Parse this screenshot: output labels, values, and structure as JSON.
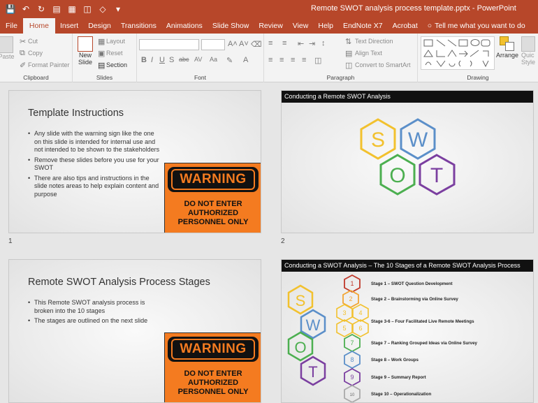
{
  "window": {
    "title": "Remote SWOT analysis process template.pptx  -  PowerPoint"
  },
  "tabs": [
    "File",
    "Home",
    "Insert",
    "Design",
    "Transitions",
    "Animations",
    "Slide Show",
    "Review",
    "View",
    "Help",
    "EndNote X7",
    "Acrobat"
  ],
  "active_tab": "Home",
  "tell_me": "Tell me what you want to do",
  "ribbon": {
    "clipboard": {
      "paste": "Paste",
      "cut": "Cut",
      "copy": "Copy",
      "format_painter": "Format Painter",
      "label": "Clipboard"
    },
    "slides": {
      "new_slide_1": "New",
      "new_slide_2": "Slide",
      "layout": "Layout",
      "reset": "Reset",
      "section": "Section",
      "label": "Slides"
    },
    "font": {
      "label": "Font"
    },
    "paragraph": {
      "text_direction": "Text Direction",
      "align_text": "Align Text",
      "convert_smartart": "Convert to SmartArt",
      "label": "Paragraph"
    },
    "drawing": {
      "arrange": "Arrange",
      "quick_styles_1": "Quic",
      "quick_styles_2": "Style",
      "label": "Drawing"
    }
  },
  "slides": [
    {
      "number": "1",
      "title": "Template Instructions",
      "bullets": [
        "Any slide with the warning sign like the one on this slide is intended for internal use and not intended to be shown to the stakeholders",
        "Remove these slides before you use for your SWOT",
        "There are also tips and instructions in the slide notes areas to help explain content and purpose"
      ],
      "warning": {
        "word": "WARNING",
        "lines": [
          "DO NOT ENTER",
          "AUTHORIZED",
          "PERSONNEL ONLY"
        ]
      }
    },
    {
      "number": "2",
      "header": "Conducting a Remote SWOT Analysis",
      "letters": [
        "S",
        "W",
        "O",
        "T"
      ]
    },
    {
      "title": "Remote SWOT Analysis Process Stages",
      "bullets": [
        "This Remote SWOT analysis process is broken into the 10 stages",
        "The stages are outlined on the next slide"
      ],
      "warning": {
        "word": "WARNING",
        "lines": [
          "DO NOT ENTER",
          "AUTHORIZED",
          "PERSONNEL ONLY"
        ]
      }
    },
    {
      "header": "Conducting a SWOT Analysis – The 10 Stages of a Remote SWOT Analysis Process",
      "letters": [
        "S",
        "W",
        "O",
        "T"
      ],
      "hex_numbers": [
        "1",
        "2",
        "3",
        "4",
        "5",
        "6",
        "7",
        "8",
        "9",
        "10"
      ],
      "stages": [
        "Stage 1 – SWOT Question Development",
        "Stage 2 – Brainstorming via Online Survey",
        "Stage 3-6 – Four Facilitated Live Remote Meetings",
        "Stage 7 – Ranking Grouped Ideas via Online Survey",
        "Stage 8 – Work Groups",
        "Stage 9 – Summary Report",
        "Stage 10 – Operationalization"
      ]
    }
  ],
  "colors": {
    "accent": "#b7472a",
    "swot_s": "#f2c12e",
    "swot_w": "#5b8fc9",
    "swot_o": "#4caf50",
    "swot_t": "#7b3fa0",
    "stage1": "#c0392b",
    "stage2_6": "#f2a533",
    "warning_orange": "#f47b20"
  }
}
